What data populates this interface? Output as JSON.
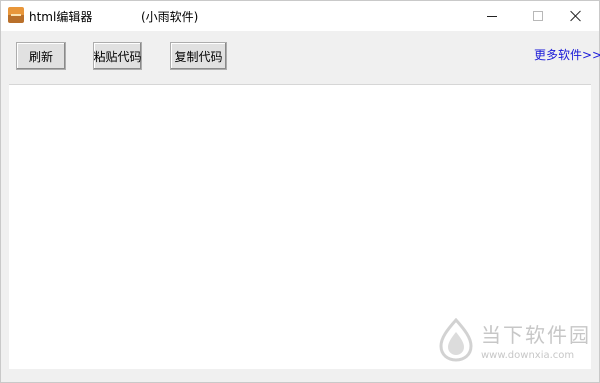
{
  "window": {
    "title": "html编辑器",
    "subtitle": "(小雨软件)"
  },
  "toolbar": {
    "refresh_label": "刷新",
    "paste_label": "粘贴代码",
    "copy_label": "复制代码",
    "more_link": "更多软件>>"
  },
  "editor": {
    "content": ""
  },
  "watermark": {
    "brand": "当下软件园",
    "url": "www.downxia.com"
  },
  "colors": {
    "link": "#1a1ad8",
    "window_bg": "#f0f0f0",
    "editor_bg": "#ffffff"
  },
  "icons": [
    "app-icon",
    "minimize-icon",
    "maximize-icon",
    "close-icon",
    "watermark-logo-icon"
  ]
}
